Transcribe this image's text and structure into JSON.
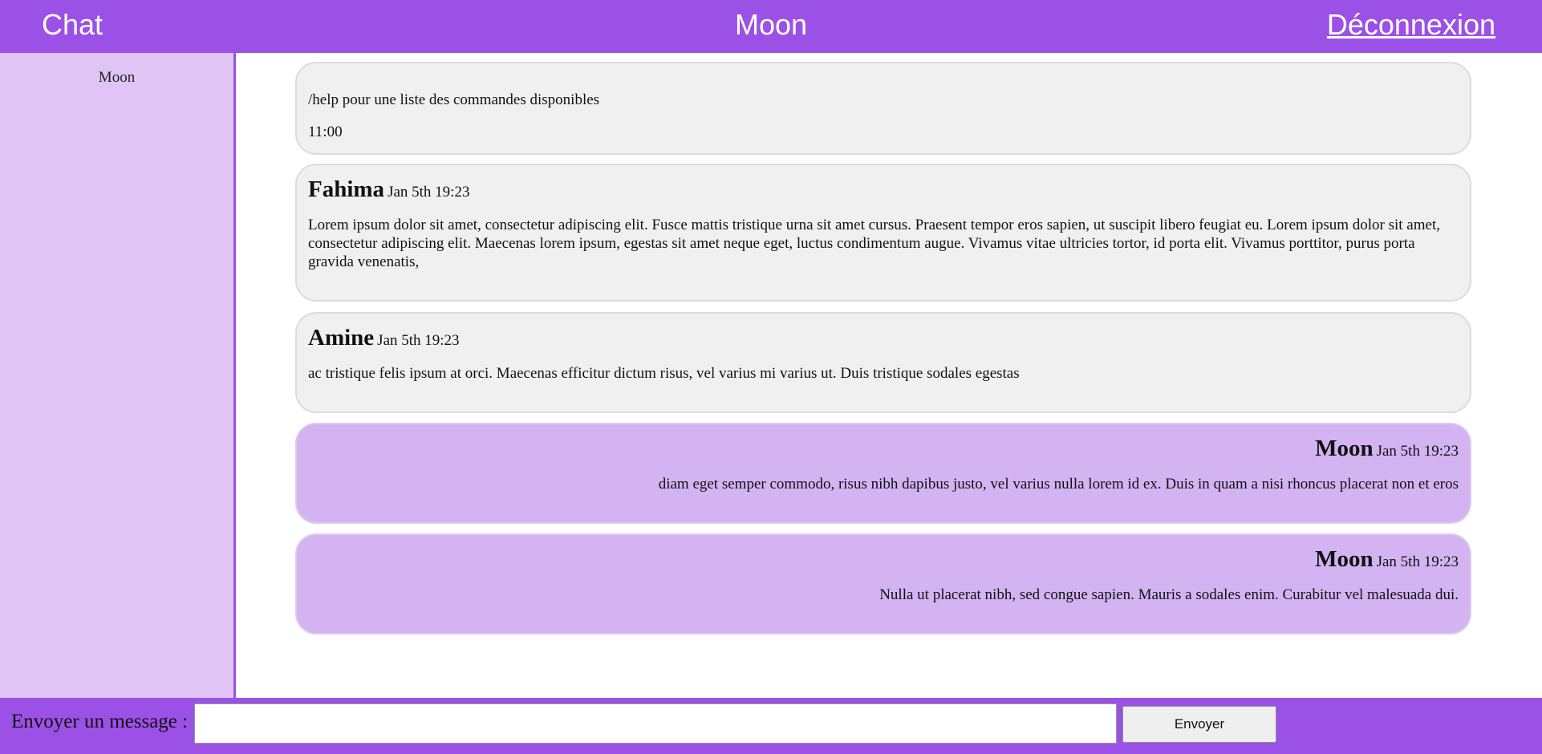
{
  "header": {
    "brand": "Chat",
    "room_title": "Moon",
    "logout_label": "Déconnexion"
  },
  "sidebar": {
    "users": [
      {
        "name": "Moon"
      }
    ]
  },
  "messages": [
    {
      "kind": "system",
      "text": "/help pour une liste des commandes disponibles",
      "time": "11:00"
    },
    {
      "kind": "other",
      "author": "Fahima",
      "time": "Jan 5th 19:23",
      "text": "Lorem ipsum dolor sit amet, consectetur adipiscing elit. Fusce mattis tristique urna sit amet cursus. Praesent tempor eros sapien, ut suscipit libero feugiat eu. Lorem ipsum dolor sit amet, consectetur adipiscing elit. Maecenas lorem ipsum, egestas sit amet neque eget, luctus condimentum augue. Vivamus vitae ultricies tortor, id porta elit. Vivamus porttitor, purus porta gravida venenatis,"
    },
    {
      "kind": "other",
      "author": "Amine",
      "time": "Jan 5th 19:23",
      "text": "ac tristique felis ipsum at orci. Maecenas efficitur dictum risus, vel varius mi varius ut. Duis tristique sodales egestas"
    },
    {
      "kind": "own",
      "author": "Moon",
      "time": "Jan 5th 19:23",
      "text": "diam eget semper commodo, risus nibh dapibus justo, vel varius nulla lorem id ex. Duis in quam a nisi rhoncus placerat non et eros"
    },
    {
      "kind": "own",
      "author": "Moon",
      "time": "Jan 5th 19:23",
      "text": "Nulla ut placerat nibh, sed congue sapien. Mauris a sodales enim. Curabitur vel malesuada dui."
    }
  ],
  "composer": {
    "label": "Envoyer un message :",
    "input_value": "",
    "send_label": "Envoyer"
  },
  "colors": {
    "accent": "#9b51e6",
    "sidebar_bg": "#dfc4f5",
    "own_bubble": "#d4b3f2",
    "other_bubble": "#f0f0f0"
  }
}
